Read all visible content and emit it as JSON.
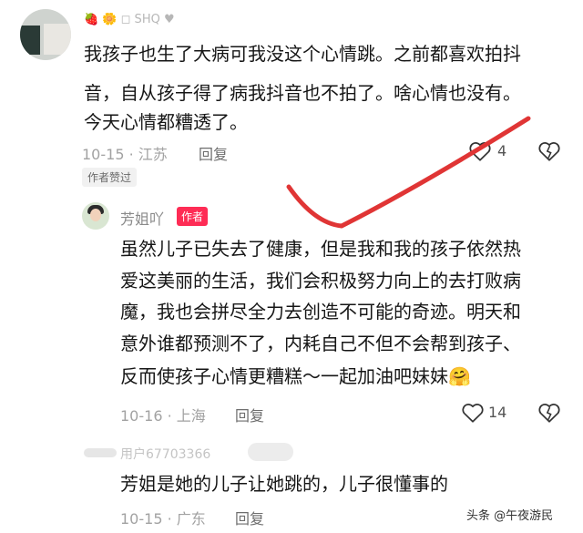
{
  "comment1": {
    "username": "🍓 🌼 ◻ SHQ ♥",
    "text_lines": [
      "我孩子也生了大病可我没这个心情跳。之前都喜欢拍抖",
      "音，自从孩子得了病我抖音也不拍了。啥心情也没有。",
      "今天心情都糟透了。"
    ],
    "meta": "10-15 · 江苏",
    "reply_label": "回复",
    "like_count": "4",
    "liked_badge": "作者赞过"
  },
  "reply": {
    "username": "芳姐吖",
    "author_badge": "作者",
    "text_lines": [
      "虽然儿子已失去了健康，但是我和我的孩子依然热",
      "爱这美丽的生活，我们会积极努力向上的去打败病",
      "魔，我也会拼尽全力去创造不可能的奇迹。明天和",
      "意外谁都预测不了，内耗自己不但不会帮到孩子、",
      "反而使孩子心情更糟糕～一起加油吧妹妹🤗"
    ],
    "meta": "10-16 · 上海",
    "reply_label": "回复",
    "like_count": "14"
  },
  "comment3": {
    "username": "用户67703366",
    "text": "芳姐是她的儿子让她跳的，儿子很懂事的",
    "meta": "10-15 · 广东",
    "reply_label": "回复"
  },
  "watermark": "头条 @午夜游民",
  "colors": {
    "annotation": "#e03535",
    "author_badge": "#fe2c55"
  }
}
